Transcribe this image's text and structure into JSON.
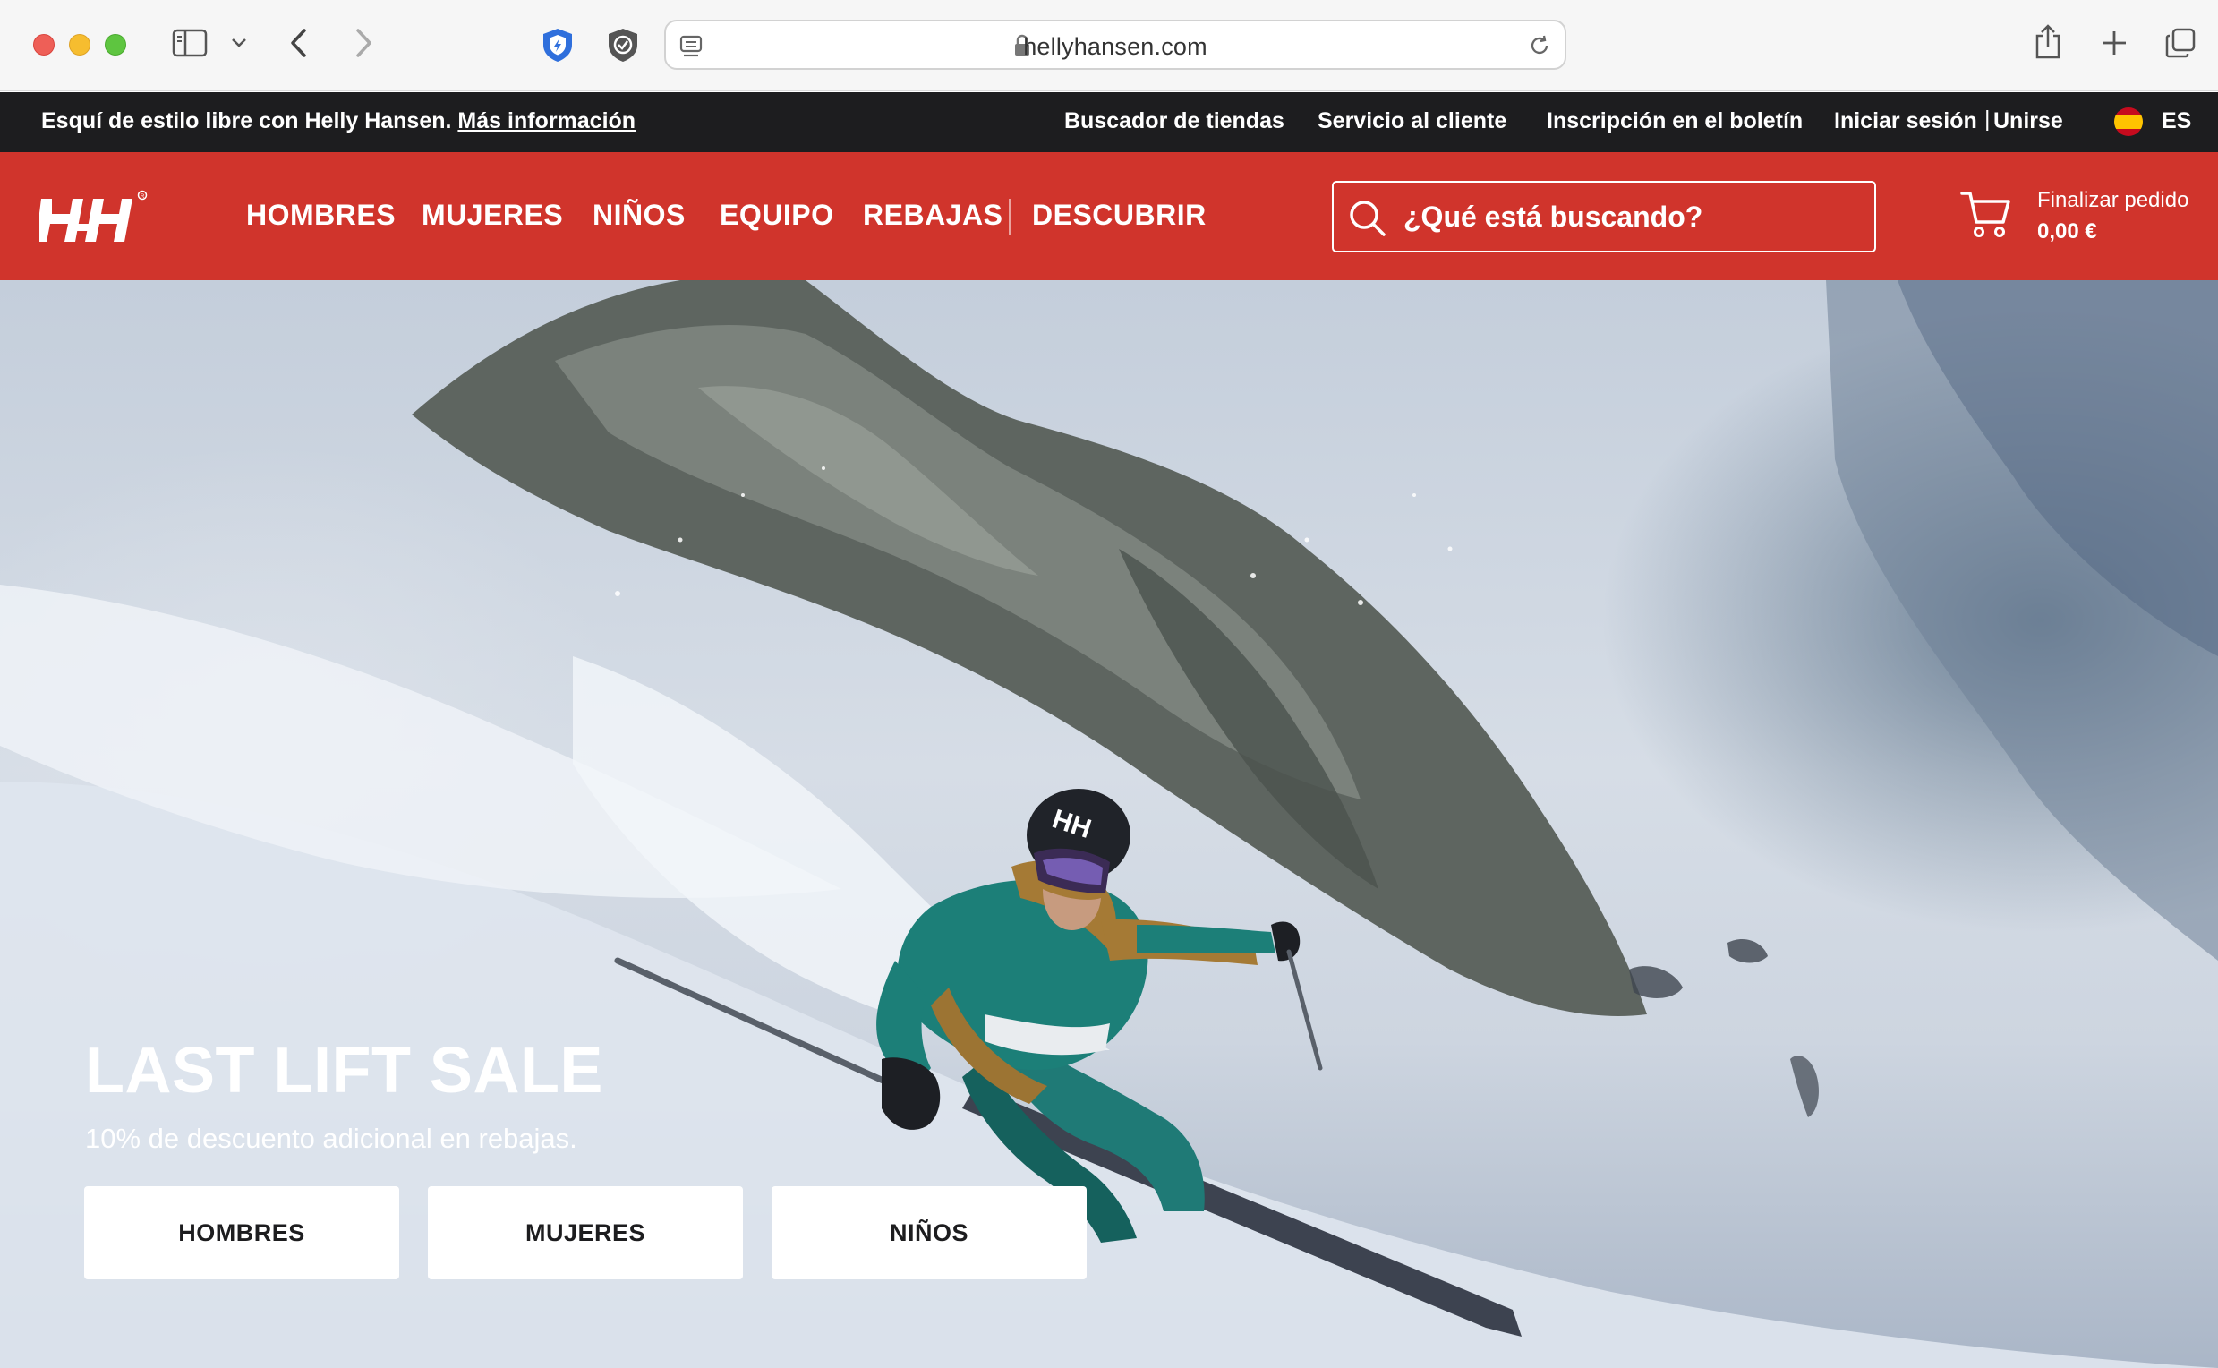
{
  "browser": {
    "url": "hellyhansen.com",
    "icons": [
      "sidebar-icon",
      "chevron-down-icon",
      "back-icon",
      "forward-icon",
      "shield-icon",
      "privacy-shield-icon",
      "reader-icon",
      "lock-icon",
      "reload-icon",
      "share-icon",
      "new-tab-icon",
      "tabs-overview-icon"
    ]
  },
  "promo": {
    "message": "Esquí de estilo libre con Helly Hansen.",
    "link": "Más información",
    "utility_links": {
      "store_finder": "Buscador de tiendas",
      "customer_service": "Servicio al cliente",
      "newsletter": "Inscripción en el boletín",
      "sign_in": "Iniciar sesión",
      "separator": "|",
      "join": "Unirse"
    },
    "language": "ES"
  },
  "nav": {
    "brand_color": "#d0342c",
    "items": [
      "HOMBRES",
      "MUJERES",
      "NIÑOS",
      "EQUIPO",
      "REBAJAS",
      "DESCUBRIR"
    ],
    "search_placeholder": "¿Qué está buscando?",
    "cart": {
      "label": "Finalizar pedido",
      "total": "0,00 €"
    }
  },
  "hero": {
    "title": "LAST LIFT SALE",
    "subtitle": "10% de descuento adicional en rebajas.",
    "buttons": [
      "HOMBRES",
      "MUJERES",
      "NIÑOS"
    ]
  }
}
